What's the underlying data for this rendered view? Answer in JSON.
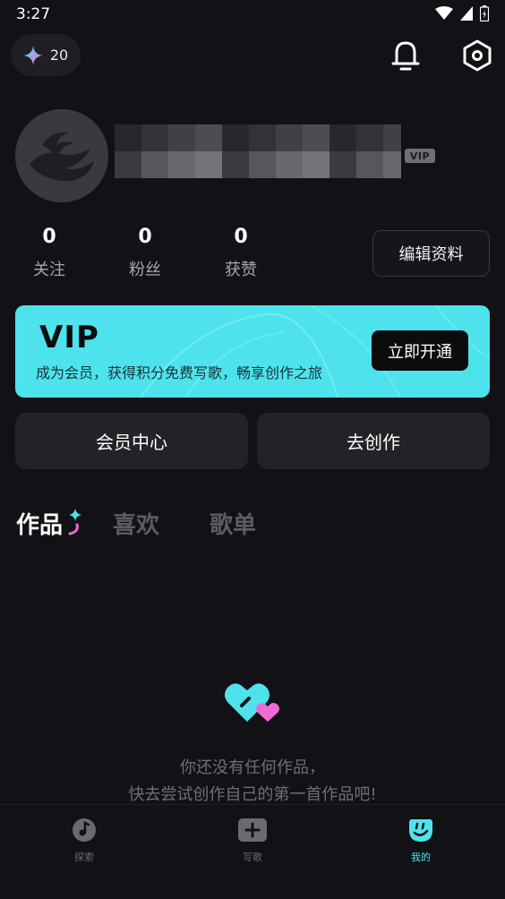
{
  "status_bar": {
    "time": "3:27"
  },
  "credits": {
    "count": "20"
  },
  "profile": {
    "vip_tag": "VIP"
  },
  "stats": [
    {
      "value": "0",
      "label": "关注"
    },
    {
      "value": "0",
      "label": "粉丝"
    },
    {
      "value": "0",
      "label": "获赞"
    }
  ],
  "edit_profile_label": "编辑资料",
  "vip_banner": {
    "title": "VIP",
    "subtitle": "成为会员，获得积分免费写歌，畅享创作之旅",
    "button": "立即开通"
  },
  "actions": {
    "member_center": "会员中心",
    "create": "去创作"
  },
  "tabs": [
    {
      "label": "作品",
      "active": true
    },
    {
      "label": "喜欢",
      "active": false
    },
    {
      "label": "歌单",
      "active": false
    }
  ],
  "empty_state": {
    "line1": "你还没有任何作品，",
    "line2": "快去尝试创作自己的第一首作品吧!"
  },
  "bottom_nav": [
    {
      "label": "探索",
      "icon": "explore-disc-icon",
      "active": false
    },
    {
      "label": "写歌",
      "icon": "write-plus-icon",
      "active": false
    },
    {
      "label": "我的",
      "icon": "me-face-icon",
      "active": true
    }
  ],
  "colors": {
    "background": "#121116",
    "accent": "#4ee3ec",
    "pink": "#f06ad7",
    "inactive_tab": "#5d5c63"
  }
}
